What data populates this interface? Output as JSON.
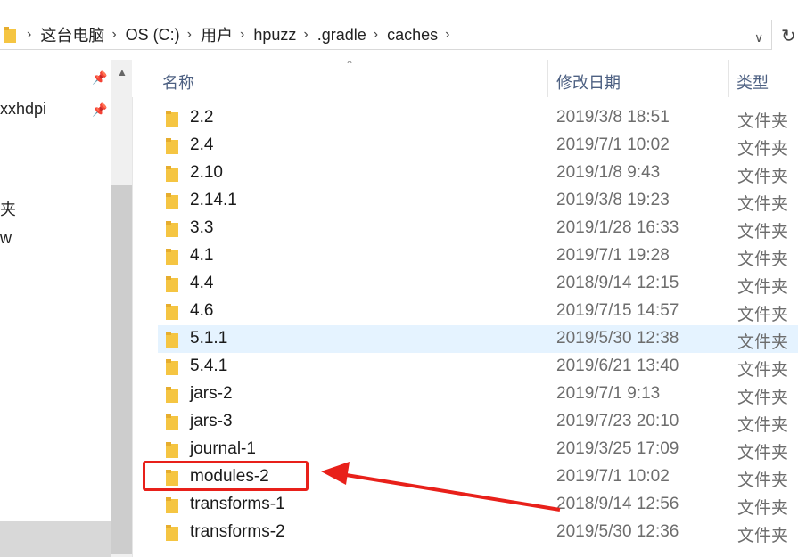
{
  "address": {
    "crumbs": [
      "这台电脑",
      "OS (C:)",
      "用户",
      "hpuzz",
      ".gradle",
      "caches"
    ]
  },
  "nav": {
    "items": [
      {
        "label": "xxhdpi",
        "pinned": true
      },
      {
        "label": "夹",
        "pinned": false
      },
      {
        "label": "w",
        "pinned": false
      }
    ]
  },
  "columns": {
    "name": "名称",
    "date": "修改日期",
    "type": "类型"
  },
  "rows": [
    {
      "name": "2.2",
      "date": "2019/3/8 18:51",
      "type": "文件夹"
    },
    {
      "name": "2.4",
      "date": "2019/7/1 10:02",
      "type": "文件夹"
    },
    {
      "name": "2.10",
      "date": "2019/1/8 9:43",
      "type": "文件夹"
    },
    {
      "name": "2.14.1",
      "date": "2019/3/8 19:23",
      "type": "文件夹"
    },
    {
      "name": "3.3",
      "date": "2019/1/28 16:33",
      "type": "文件夹"
    },
    {
      "name": "4.1",
      "date": "2019/7/1 19:28",
      "type": "文件夹"
    },
    {
      "name": "4.4",
      "date": "2018/9/14 12:15",
      "type": "文件夹"
    },
    {
      "name": "4.6",
      "date": "2019/7/15 14:57",
      "type": "文件夹"
    },
    {
      "name": "5.1.1",
      "date": "2019/5/30 12:38",
      "type": "文件夹",
      "selected": true
    },
    {
      "name": "5.4.1",
      "date": "2019/6/21 13:40",
      "type": "文件夹"
    },
    {
      "name": "jars-2",
      "date": "2019/7/1 9:13",
      "type": "文件夹"
    },
    {
      "name": "jars-3",
      "date": "2019/7/23 20:10",
      "type": "文件夹"
    },
    {
      "name": "journal-1",
      "date": "2019/3/25 17:09",
      "type": "文件夹"
    },
    {
      "name": "modules-2",
      "date": "2019/7/1 10:02",
      "type": "文件夹",
      "annotated": true
    },
    {
      "name": "transforms-1",
      "date": "2018/9/14 12:56",
      "type": "文件夹"
    },
    {
      "name": "transforms-2",
      "date": "2019/5/30 12:36",
      "type": "文件夹"
    }
  ],
  "colors": {
    "folder": "#f5c542",
    "selection": "#e5f3ff",
    "annotation": "#e8201a"
  }
}
